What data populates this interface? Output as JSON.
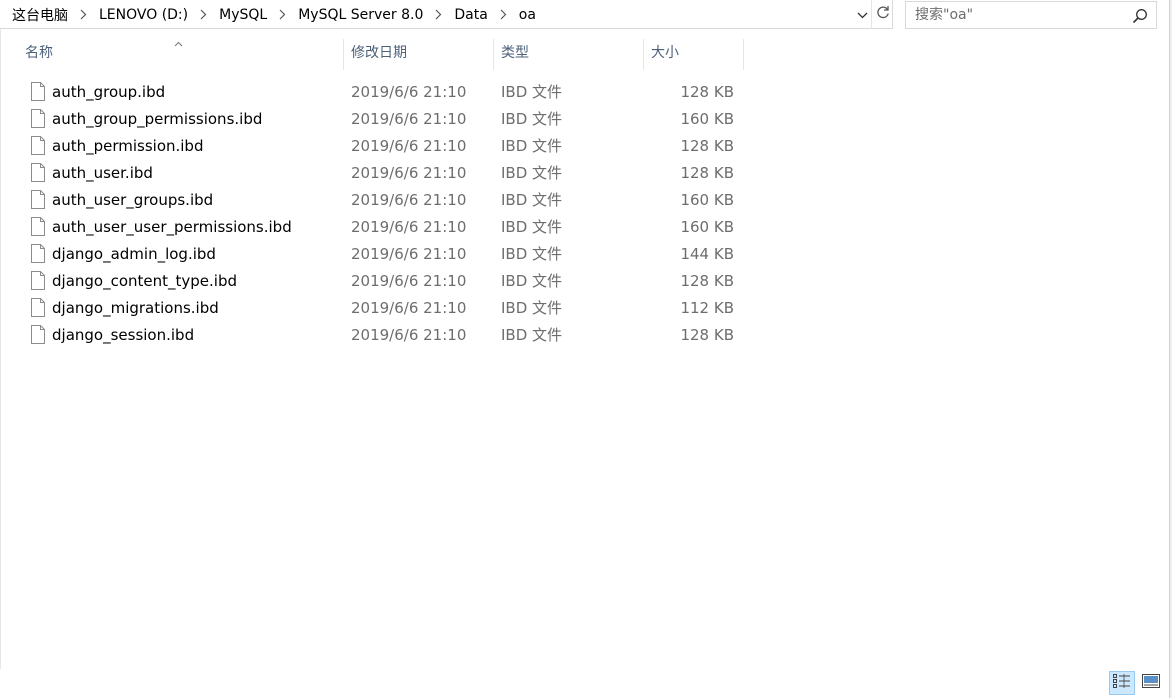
{
  "breadcrumb": {
    "items": [
      "这台电脑",
      "LENOVO (D:)",
      "MySQL",
      "MySQL Server 8.0",
      "Data",
      "oa"
    ]
  },
  "search": {
    "placeholder": "搜索\"oa\""
  },
  "columns": {
    "name": "名称",
    "date": "修改日期",
    "type": "类型",
    "size": "大小"
  },
  "files": [
    {
      "name": "auth_group.ibd",
      "date": "2019/6/6 21:10",
      "type": "IBD 文件",
      "size": "128 KB"
    },
    {
      "name": "auth_group_permissions.ibd",
      "date": "2019/6/6 21:10",
      "type": "IBD 文件",
      "size": "160 KB"
    },
    {
      "name": "auth_permission.ibd",
      "date": "2019/6/6 21:10",
      "type": "IBD 文件",
      "size": "128 KB"
    },
    {
      "name": "auth_user.ibd",
      "date": "2019/6/6 21:10",
      "type": "IBD 文件",
      "size": "128 KB"
    },
    {
      "name": "auth_user_groups.ibd",
      "date": "2019/6/6 21:10",
      "type": "IBD 文件",
      "size": "160 KB"
    },
    {
      "name": "auth_user_user_permissions.ibd",
      "date": "2019/6/6 21:10",
      "type": "IBD 文件",
      "size": "160 KB"
    },
    {
      "name": "django_admin_log.ibd",
      "date": "2019/6/6 21:10",
      "type": "IBD 文件",
      "size": "144 KB"
    },
    {
      "name": "django_content_type.ibd",
      "date": "2019/6/6 21:10",
      "type": "IBD 文件",
      "size": "128 KB"
    },
    {
      "name": "django_migrations.ibd",
      "date": "2019/6/6 21:10",
      "type": "IBD 文件",
      "size": "112 KB"
    },
    {
      "name": "django_session.ibd",
      "date": "2019/6/6 21:10",
      "type": "IBD 文件",
      "size": "128 KB"
    }
  ],
  "icons": {
    "breadcrumb_separator": "chevron-right-icon",
    "address_dropdown": "chevron-down-icon",
    "refresh": "refresh-icon",
    "search": "search-icon",
    "file": "file-icon",
    "sort": "sort-ascending-icon",
    "view_details": "details-view-icon",
    "view_tiles": "large-icons-view-icon"
  },
  "colors": {
    "header_text": "#4c607a",
    "secondary_text": "#6d6d6d",
    "selected_view_bg": "#cce8ff",
    "selected_view_border": "#99c9ef"
  }
}
